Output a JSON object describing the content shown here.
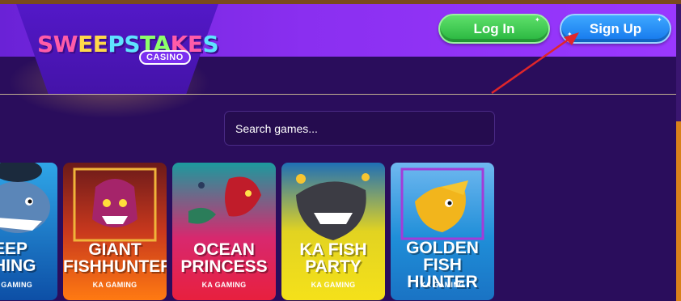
{
  "brand": {
    "logo_letters": [
      "SW",
      "EE",
      "PS",
      "TA",
      "KE",
      "S"
    ],
    "logo_badge": "CASINO"
  },
  "header": {
    "login_label": "Log In",
    "signup_label": "Sign Up"
  },
  "search": {
    "placeholder": "Search games..."
  },
  "games": [
    {
      "title": "EEP\nHING",
      "studio": "A GAMING"
    },
    {
      "title": "GIANT\nFISHHUNTER",
      "studio": "KA GAMING"
    },
    {
      "title": "OCEAN\nPRINCESS",
      "studio": "KA GAMING"
    },
    {
      "title": "KA FISH\nPARTY",
      "studio": "KA GAMING"
    },
    {
      "title": "GOLDEN FISH\nHUNTER",
      "studio": "KA GAMING"
    }
  ],
  "colors": {
    "background": "#2a0d5c",
    "header": "#8a2ff0",
    "login_green": "#27b53e",
    "signup_blue": "#1477ec",
    "annotation_arrow": "#e0262a"
  },
  "icons": {
    "annotation": "red-arrow-icon"
  }
}
